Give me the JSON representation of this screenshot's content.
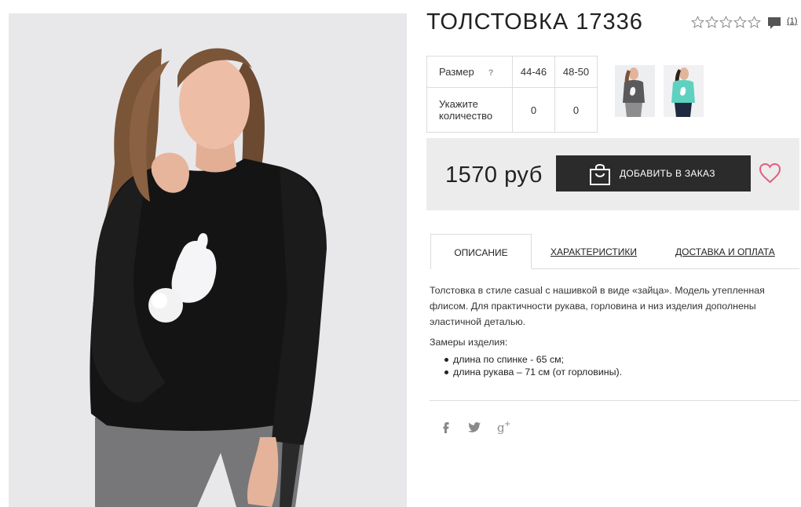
{
  "product": {
    "title": "ТОЛСТОВКА 17336",
    "rating": 0,
    "rating_max": 5,
    "review_count": "(1)",
    "photo_icon": "product-photo",
    "thumbnail_icons": [
      "thumbnail-gray-sweatshirt",
      "thumbnail-mint-sweatshirt"
    ]
  },
  "sizes": {
    "size_label": "Размер",
    "help_mark": "?",
    "quantity_label_line1": "Укажите",
    "quantity_label_line2": "количество",
    "options": [
      {
        "size": "44-46",
        "quantity": "0"
      },
      {
        "size": "48-50",
        "quantity": "0"
      }
    ]
  },
  "purchase": {
    "price": "1570 руб",
    "add_to_order_label": "ДОБАВИТЬ В ЗАКАЗ",
    "bag_icon": "shopping-bag-icon",
    "wishlist_icon": "heart-icon",
    "accent_color": "#e0607e",
    "button_color": "#2b2b2b"
  },
  "tabs": [
    {
      "label": "ОПИСАНИЕ",
      "active": true
    },
    {
      "label": "ХАРАКТЕРИСТИКИ",
      "active": false
    },
    {
      "label": "ДОСТАВКА И ОПЛАТА",
      "active": false
    }
  ],
  "description": {
    "text": "Толстовка в стиле casual с нашивкой в виде «зайца». Модель утепленная флисом. Для практичности рукава, горловина и низ изделия дополнены эластичной деталью.",
    "measures_title": "Замеры изделия:",
    "measures": [
      "длина по спинке - 65 см;",
      "длина рукава – 71 см (от горловины)."
    ]
  },
  "social": {
    "icons": [
      "facebook-icon",
      "twitter-icon",
      "google-plus-icon"
    ],
    "icon_color": "#8a8a8a"
  }
}
